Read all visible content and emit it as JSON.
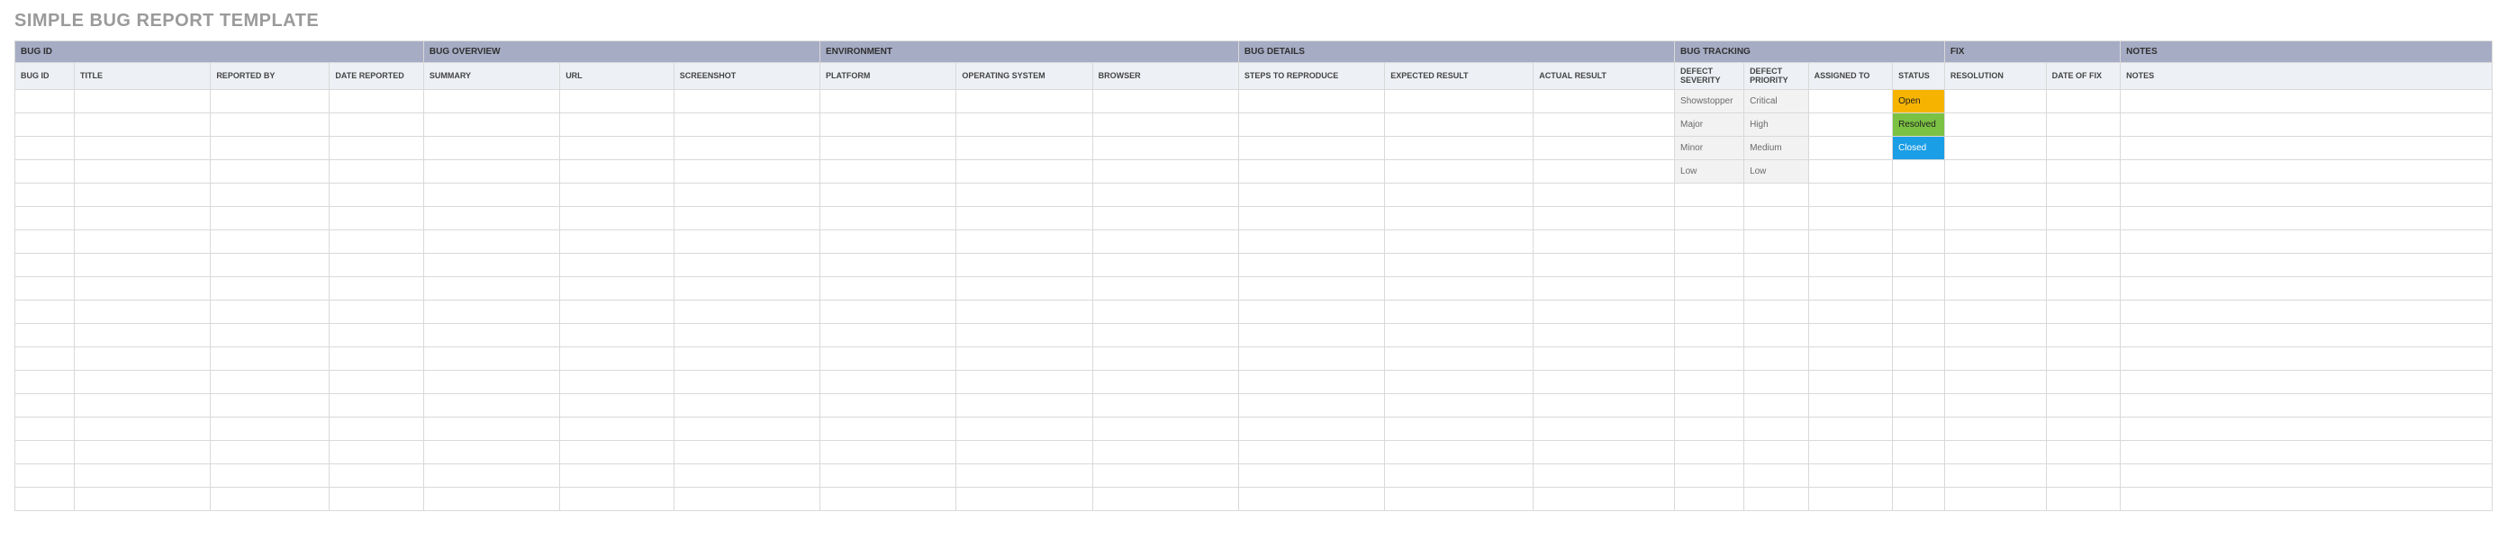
{
  "title": "SIMPLE BUG REPORT TEMPLATE",
  "groups": [
    {
      "label": "BUG ID",
      "span": 4
    },
    {
      "label": "BUG OVERVIEW",
      "span": 3
    },
    {
      "label": "ENVIRONMENT",
      "span": 3
    },
    {
      "label": "BUG DETAILS",
      "span": 3
    },
    {
      "label": "BUG TRACKING",
      "span": 4
    },
    {
      "label": "FIX",
      "span": 2
    },
    {
      "label": "NOTES",
      "span": 1
    }
  ],
  "columns": [
    "BUG ID",
    "TITLE",
    "REPORTED BY",
    "DATE REPORTED",
    "SUMMARY",
    "URL",
    "SCREENSHOT",
    "PLATFORM",
    "OPERATING SYSTEM",
    "BROWSER",
    "STEPS TO REPRODUCE",
    "EXPECTED RESULT",
    "ACTUAL RESULT",
    "DEFECT SEVERITY",
    "DEFECT PRIORITY",
    "ASSIGNED TO",
    "STATUS",
    "RESOLUTION",
    "DATE OF FIX",
    "NOTES"
  ],
  "rows": [
    {
      "severity": "Showstopper",
      "priority": "Critical",
      "status": "Open",
      "status_class": "status-open"
    },
    {
      "severity": "Major",
      "priority": "High",
      "status": "Resolved",
      "status_class": "status-resolved"
    },
    {
      "severity": "Minor",
      "priority": "Medium",
      "status": "Closed",
      "status_class": "status-closed"
    },
    {
      "severity": "Low",
      "priority": "Low",
      "status": "",
      "status_class": ""
    }
  ],
  "empty_row_count": 14,
  "legend": {
    "severity_options": [
      "Showstopper",
      "Major",
      "Minor",
      "Low"
    ],
    "priority_options": [
      "Critical",
      "High",
      "Medium",
      "Low"
    ],
    "status_options": [
      "Open",
      "Resolved",
      "Closed"
    ]
  },
  "colors": {
    "group_header_bg": "#a6acc4",
    "sub_header_bg": "#edf0f5",
    "status_open": "#f6b400",
    "status_resolved": "#7bc143",
    "status_closed": "#1a9ee6"
  }
}
